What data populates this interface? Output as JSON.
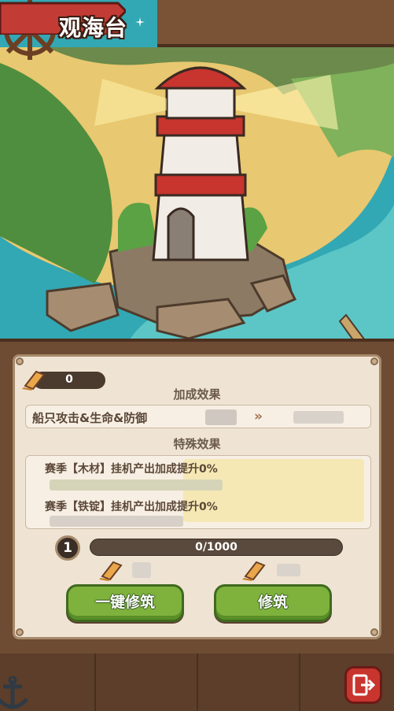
{
  "header": {
    "title": "观海台",
    "avatar_icon": "mushroom-avatar-icon",
    "star_icon": "sparkle-icon"
  },
  "resources": {
    "wood_count": "0",
    "wood_icon": "wood-plank-icon"
  },
  "bonus": {
    "section_title": "加成效果",
    "stat_label": "船只攻击&生命&防御",
    "arrow": "»"
  },
  "special": {
    "section_title": "特殊效果",
    "lines": [
      "赛季【木材】挂机产出加成提升0%",
      "赛季【铁锭】挂机产出加成提升0%"
    ]
  },
  "level": {
    "value": "1",
    "progress_text": "0/1000",
    "progress_fraction": 0
  },
  "buttons": {
    "quick_build": "一键修筑",
    "build": "修筑"
  },
  "nav": {
    "exit_icon": "exit-door-icon",
    "anchor_icon": "anchor-icon"
  },
  "colors": {
    "primary_button": "#7fb23d",
    "exit_button": "#c8342e",
    "title_ribbon": "#c33b35"
  }
}
